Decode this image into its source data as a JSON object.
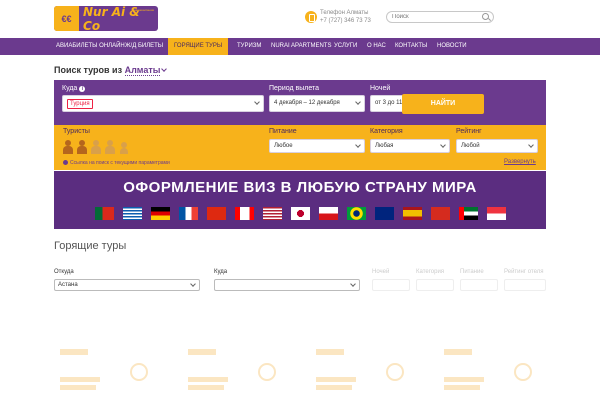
{
  "header": {
    "logo_text": "Nur Ai & Co",
    "logo_sub": "авиакомпания",
    "phone_label": "Телефон Алматы",
    "phone_number": "+7 (727) 346 73 73",
    "search_placeholder": "Поиск"
  },
  "nav": {
    "items": [
      {
        "label": "Авиабилеты онлайн",
        "active": false
      },
      {
        "label": "Ж/д билеты",
        "active": false
      },
      {
        "label": "Горящие туры",
        "active": true
      },
      {
        "label": "Туризм",
        "active": false
      },
      {
        "label": "Nurai Apartments",
        "active": false
      },
      {
        "label": "Услуги",
        "active": false
      },
      {
        "label": "О нас",
        "active": false
      },
      {
        "label": "Контакты",
        "active": false
      },
      {
        "label": "Новости",
        "active": false
      }
    ]
  },
  "tour_search": {
    "title": "Поиск туров из",
    "city": "Алматы",
    "where_label": "Куда",
    "where_tag": "Турция",
    "period_label": "Период вылета",
    "period_value": "4 декабря – 12 декабря",
    "nights_label": "Ночей",
    "nights_value": "от 3 до 11",
    "find_button": "НАЙТИ"
  },
  "filters": {
    "tourists_label": "Туристы",
    "tourists_selected": 2,
    "tourists_total": 5,
    "link_text": "Ссылка на поиск с текущими параметрами",
    "food_label": "Питание",
    "food_value": "Любое",
    "category_label": "Категория",
    "category_value": "Любая",
    "rating_label": "Рейтинг",
    "rating_value": "Любой",
    "expand_link": "Развернуть"
  },
  "banner": {
    "text": "ОФОРМЛЕНИЕ ВИЗ В ЛЮБУЮ СТРАНУ МИРА",
    "flags": [
      "portugal-flag",
      "greece-flag",
      "germany-flag",
      "france-flag",
      "china-flag",
      "canada-flag",
      "usa-flag",
      "japan-flag",
      "czech-flag",
      "brazil-flag",
      "australia-flag",
      "spain-flag",
      "switzerland-flag",
      "uae-flag",
      "singapore-flag"
    ]
  },
  "hot_tours": {
    "title": "Горящие туры",
    "from_label": "Откуда",
    "from_value": "Астана",
    "to_label": "Куда",
    "to_value": "",
    "nights_label": "Ночей",
    "category_label": "Категория",
    "food_label": "Питание",
    "rating_label": "Рейтинг отеля"
  },
  "colors": {
    "brand_purple": "#6b3a8e",
    "brand_orange": "#f7b21b"
  }
}
